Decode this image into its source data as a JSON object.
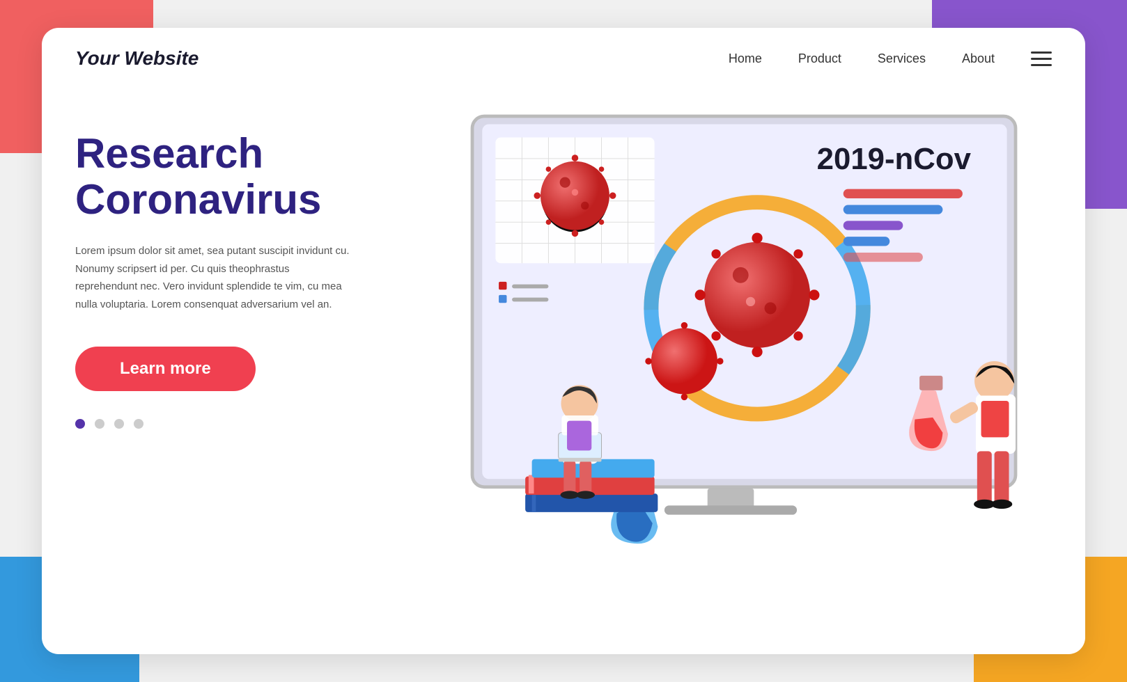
{
  "brand": "Your Website",
  "nav": {
    "links": [
      {
        "label": "Home",
        "id": "home"
      },
      {
        "label": "Product",
        "id": "product"
      },
      {
        "label": "Services",
        "id": "services"
      },
      {
        "label": "About",
        "id": "about"
      }
    ]
  },
  "hero": {
    "headline_line1": "Research",
    "headline_line2": "Coronavirus",
    "description": "Lorem ipsum dolor sit amet, sea putant suscipit invidunt cu. Nonumy scripsert id per. Cu quis theophrastus reprehendunt nec. Vero invidunt splendide te vim, cu mea nulla voluptaria. Lorem consenquat adversarium vel an.",
    "cta_label": "Learn more",
    "virus_label": "2019-nCov"
  },
  "dots": [
    {
      "active": true
    },
    {
      "active": false
    },
    {
      "active": false
    },
    {
      "active": false
    }
  ],
  "colors": {
    "brand_dark": "#2e2280",
    "cta_red": "#f04050",
    "accent_orange": "#f5a623",
    "accent_blue": "#44aaee",
    "virus_red": "#c02020",
    "bg_purple": "#8855cc"
  }
}
